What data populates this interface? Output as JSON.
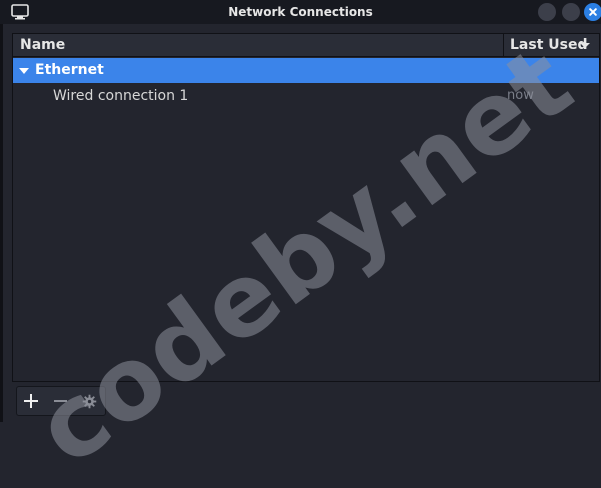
{
  "window": {
    "title": "Network Connections",
    "accent_color": "#3b84ea",
    "close_color": "#2b7fe3"
  },
  "table": {
    "columns": [
      "Name",
      "Last Used"
    ],
    "sort_indicator": "chevron-down-icon",
    "groups": [
      {
        "label": "Ethernet",
        "expanded": true,
        "selected": true,
        "connections": [
          {
            "name": "Wired connection 1",
            "last_used": "now"
          }
        ]
      }
    ]
  },
  "toolbar": {
    "buttons": [
      {
        "icon": "plus-icon",
        "enabled": true
      },
      {
        "icon": "minus-icon",
        "enabled": false
      },
      {
        "icon": "gear-icon",
        "enabled": false
      }
    ]
  },
  "watermark": "codeby.net"
}
